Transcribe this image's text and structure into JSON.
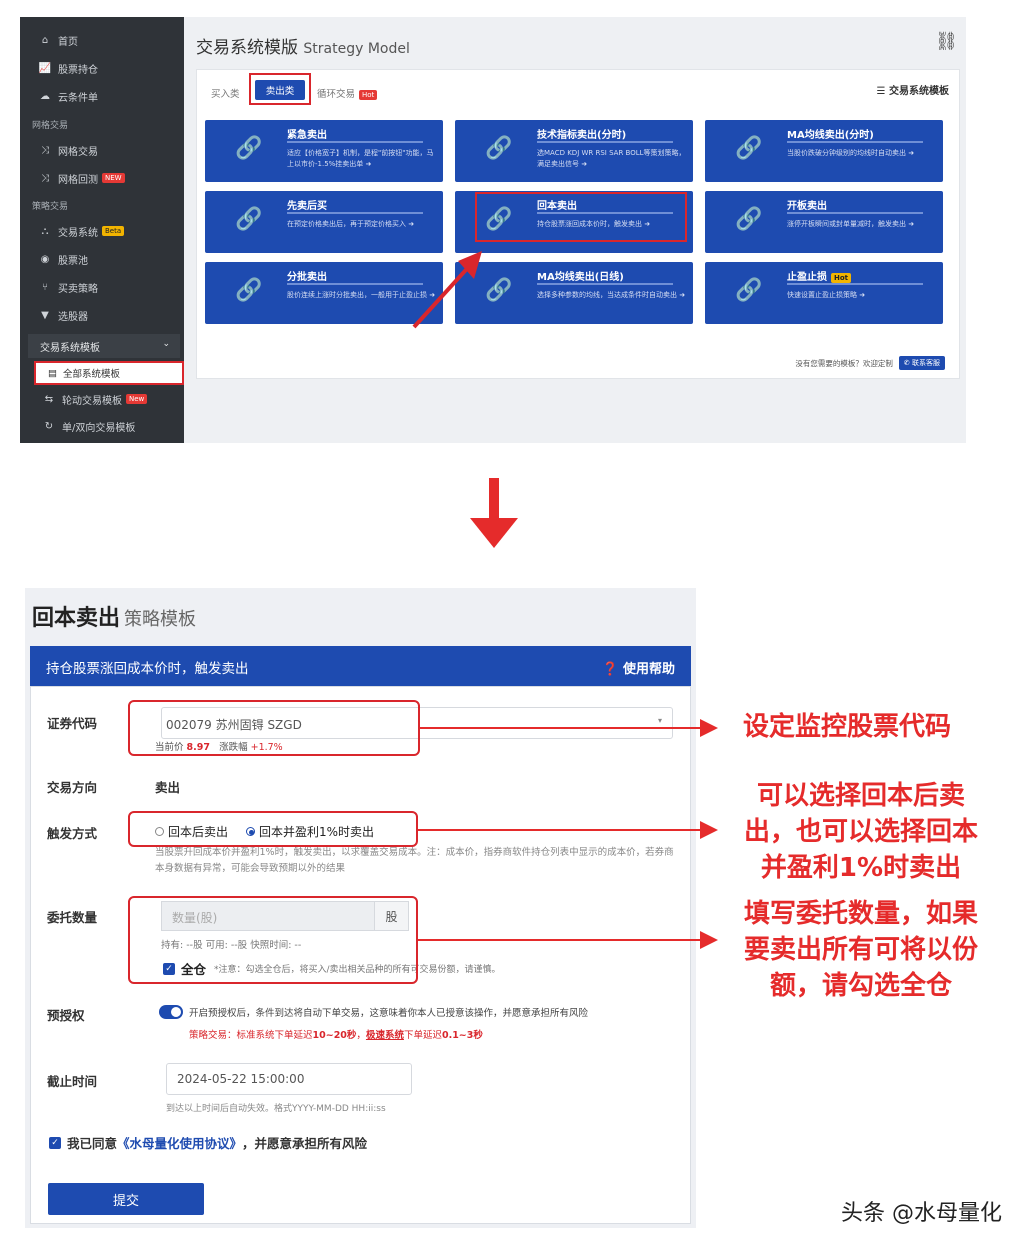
{
  "top": {
    "sidebar": {
      "items_top": [
        {
          "icon": "home-icon",
          "label": "首页"
        },
        {
          "icon": "chart-icon",
          "label": "股票持仓"
        },
        {
          "icon": "cloud-icon",
          "label": "云条件单"
        }
      ],
      "section_grid": "网格交易",
      "items_grid": [
        {
          "icon": "shuffle-icon",
          "label": "网格交易",
          "badge": ""
        },
        {
          "icon": "shuffle-icon",
          "label": "网格回测",
          "badge": "NEW"
        }
      ],
      "section_strategy": "策略交易",
      "items_strategy": [
        {
          "icon": "org-icon",
          "label": "交易系统",
          "badge": "Beta"
        },
        {
          "icon": "pool-icon",
          "label": "股票池",
          "badge": ""
        },
        {
          "icon": "branch-icon",
          "label": "买卖策略",
          "badge": ""
        },
        {
          "icon": "filter-icon",
          "label": "选股器",
          "badge": ""
        }
      ],
      "group_label": "交易系统模板",
      "active_item": "全部系统模板",
      "items_bottom": [
        {
          "icon": "swap-icon",
          "label": "轮动交易模板",
          "badge": "New"
        },
        {
          "icon": "refresh-icon",
          "label": "单/双向交易模板",
          "badge": ""
        }
      ]
    },
    "title": "交易系统模版",
    "title_sub": "Strategy Model",
    "tabs": {
      "buy": "买入类",
      "sell": "卖出类",
      "loop": "循环交易",
      "loop_badge": "Hot"
    },
    "template_label": "☰ 交易系统模板",
    "cards": [
      {
        "title": "紧急卖出",
        "badge": "",
        "desc": "适应【价格宽子】机制，是程\"前按钮\"功能，马上以市价-1.5%挂卖出单 ➜"
      },
      {
        "title": "技术指标卖出(分时)",
        "badge": "",
        "desc": "选MACD KDJ WR RSI SAR BOLL等策划策略，满足卖出信号 ➜"
      },
      {
        "title": "MA均线卖出(分时)",
        "badge": "",
        "desc": "当股价跌破分钟级别的均线时自动卖出 ➜"
      },
      {
        "title": "先卖后买",
        "badge": "",
        "desc": "在预定价格卖出后，再于预定价格买入 ➜"
      },
      {
        "title": "回本卖出",
        "badge": "",
        "desc": "持仓股票涨回成本价时，触发卖出 ➜"
      },
      {
        "title": "开板卖出",
        "badge": "",
        "desc": "涨停开板瞬间或封单量减时，触发卖出 ➜"
      },
      {
        "title": "分批卖出",
        "badge": "",
        "desc": "股价连续上涨时分批卖出，一般用于止盈止损 ➜"
      },
      {
        "title": "MA均线卖出(日线)",
        "badge": "",
        "desc": "选择多种参数的均线，当达成条件时自动卖出 ➜"
      },
      {
        "title": "止盈止损",
        "badge": "Hot",
        "desc": "快速设置止盈止损策略 ➜"
      }
    ],
    "footer_text": "没有您需要的模板？欢迎定制",
    "footer_btn": "✆ 联系客服"
  },
  "form": {
    "title": "回本卖出",
    "title_sub": "策略模板",
    "header_text": "持仓股票涨回成本价时，触发卖出",
    "help": "❓ 使用帮助",
    "labels": {
      "code": "证券代码",
      "direction": "交易方向",
      "trigger": "触发方式",
      "quantity": "委托数量",
      "preauth": "预授权",
      "deadline": "截止时间"
    },
    "code_value": "002079 苏州固锝 SZGD",
    "price_label": "当前价",
    "price_value": "8.97",
    "change_label": "涨跌幅",
    "change_value": "+1.7%",
    "direction_value": "卖出",
    "trigger_options": [
      "回本后卖出",
      "回本并盈利1%时卖出"
    ],
    "trigger_selected": 1,
    "trigger_note": "当股票升回成本价并盈利1%时，触发卖出，以求覆盖交易成本。注：成本价，指券商软件持仓列表中显示的成本价，若券商本身数据有异常，可能会导致预期以外的结果",
    "qty_placeholder": "数量(股)",
    "qty_unit": "股",
    "qty_info": "持有: --股    可用: --股    快照时间: --",
    "all_label": "全仓",
    "all_note": "*注意：勾选全仓后，将买入/卖出相关品种的所有可交易份额，请谨慎。",
    "preauth_note": "开启预授权后，条件到达将自动下单交易，这意味着你本人已授意该操作，并愿意承担所有风险",
    "preauth_note2_a": "策略交易：标准系统下单延迟",
    "preauth_note2_b": "10~20秒",
    "preauth_note2_c": "，",
    "preauth_note2_link": "极速系统",
    "preauth_note2_d": "下单延迟",
    "preauth_note2_e": "0.1~3秒",
    "deadline_value": "2024-05-22 15:00:00",
    "deadline_note": "到达以上时间后自动失效。格式YYYY-MM-DD HH:ii:ss",
    "agree_a": "我已同意",
    "agree_link": "《水母量化使用协议》",
    "agree_b": "，并愿意承担所有风险",
    "submit": "提交"
  },
  "annotations": {
    "a1": "设定监控股票代码",
    "a2_l1": "可以选择回本后卖",
    "a2_l2": "出，也可以选择回本",
    "a2_l3": "并盈利1%时卖出",
    "a3_l1": "填写委托数量，如果",
    "a3_l2": "要卖出所有可将以份",
    "a3_l3": "额，请勾选全仓"
  },
  "watermark": "头条 @水母量化",
  "colors": {
    "primary": "#1e4bb0",
    "highlight": "#d9262c",
    "annotation": "#e52b2b",
    "sidebar": "#2f3338"
  }
}
